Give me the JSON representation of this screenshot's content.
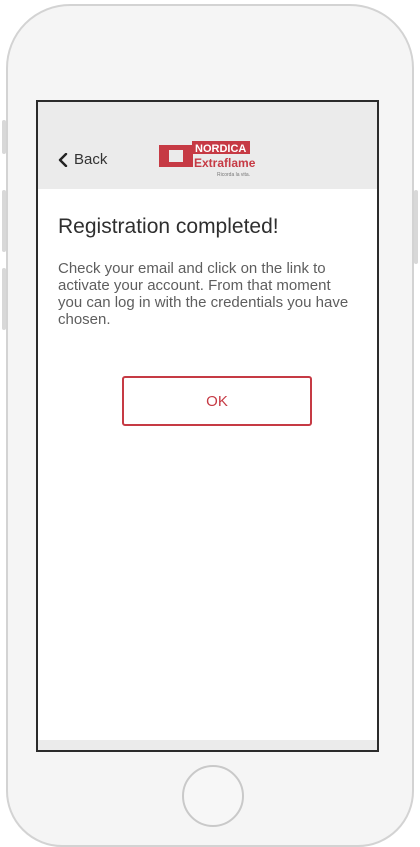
{
  "nav": {
    "back_label": "Back",
    "brand": {
      "name_top": "NORDICA",
      "name_bottom": "Extraflame",
      "tagline": "Ricorda la vita.",
      "color": "#c63a44"
    }
  },
  "main": {
    "title": "Registration completed!",
    "message": "Check your email and click on the link to activate your account. From that moment you can log in with the credentials you have chosen.",
    "ok_label": "OK"
  },
  "colors": {
    "accent": "#c63a44",
    "nav_bg": "#ebebeb",
    "text": "#2f2f2f"
  },
  "icons": {
    "back": "chevron-left-icon",
    "home": "home-button"
  }
}
